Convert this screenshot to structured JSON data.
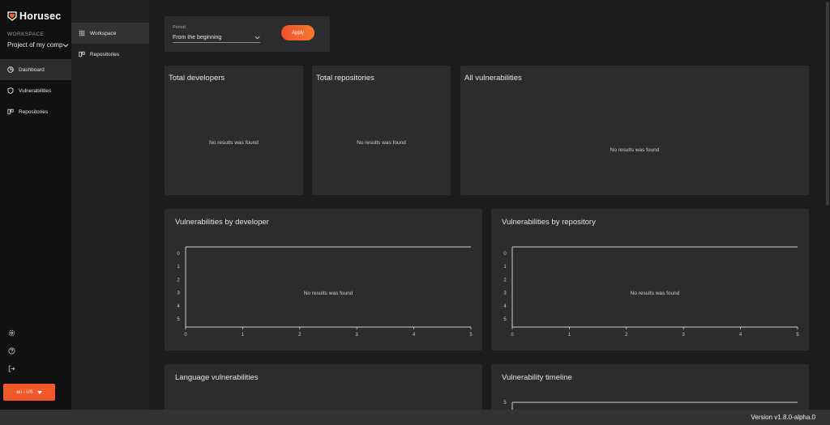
{
  "app": {
    "name": "Horusec"
  },
  "workspace": {
    "label": "WORKSPACE",
    "selected": "Project of my company"
  },
  "nav": {
    "items": [
      {
        "label": "Dashboard",
        "icon": "dashboard-icon",
        "active": true
      },
      {
        "label": "Vulnerabilities",
        "icon": "shield-icon",
        "active": false
      },
      {
        "label": "Repositories",
        "icon": "repositories-icon",
        "active": false
      }
    ]
  },
  "subnav": {
    "items": [
      {
        "label": "Workspace",
        "icon": "grid-icon",
        "active": true
      },
      {
        "label": "Repositories",
        "icon": "repositories-icon",
        "active": false
      }
    ]
  },
  "bottom_icons": [
    "gear-icon",
    "help-icon",
    "logout-icon"
  ],
  "language": {
    "label": "en - US"
  },
  "filter": {
    "period_label": "Period",
    "period_value": "From the beginning",
    "apply_label": "Apply"
  },
  "cards": {
    "total_developers": {
      "title": "Total developers",
      "empty": "No results was found"
    },
    "total_repositories": {
      "title": "Total repositories",
      "empty": "No results was found"
    },
    "all_vulnerabilities": {
      "title": "All vulnerabilities",
      "empty": "No results was found"
    },
    "language_vulnerabilities": {
      "title": "Language vulnerabilities"
    }
  },
  "chart_data": [
    {
      "type": "bar",
      "title": "Vulnerabilities by developer",
      "empty_text": "No results was found",
      "x": [
        0,
        1,
        2,
        3,
        4,
        5
      ],
      "y_ticks": [
        0,
        1,
        2,
        3,
        4,
        5
      ],
      "xlim": [
        0,
        5
      ],
      "ylim": [
        0,
        5
      ],
      "y_axis_reversed": true,
      "grid": false,
      "series": []
    },
    {
      "type": "bar",
      "title": "Vulnerabilities by repository",
      "empty_text": "No results was found",
      "x": [
        0,
        1,
        2,
        3,
        4,
        5
      ],
      "y_ticks": [
        0,
        1,
        2,
        3,
        4,
        5
      ],
      "xlim": [
        0,
        5
      ],
      "ylim": [
        0,
        5
      ],
      "y_axis_reversed": true,
      "grid": false,
      "series": []
    },
    {
      "type": "line",
      "title": "Vulnerability timeline",
      "y_ticks": [
        5
      ],
      "grid": false,
      "series": []
    }
  ],
  "colors": {
    "accent": "#f2592a",
    "sidebar": "#111112",
    "card": "#2c2c2e",
    "background": "#1c1c1e"
  },
  "status": {
    "version": "Version v1.8.0-alpha.0"
  }
}
